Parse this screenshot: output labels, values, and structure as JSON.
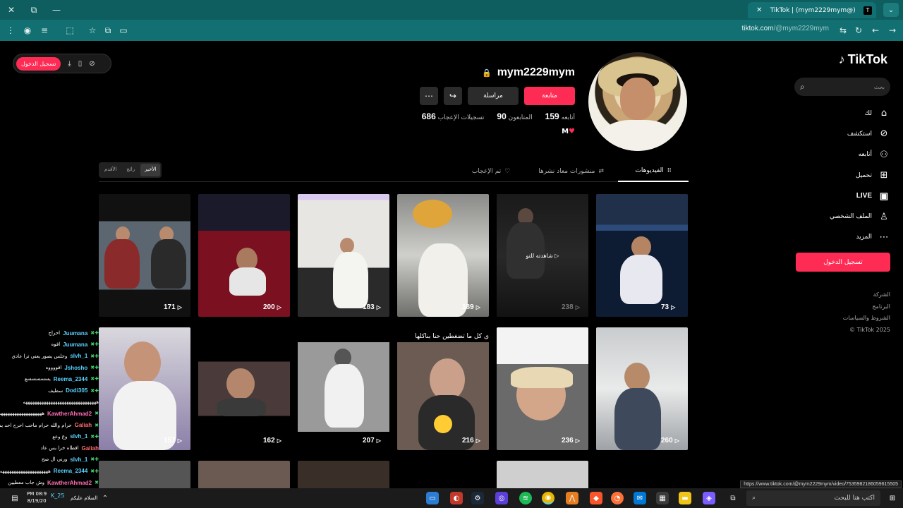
{
  "browser": {
    "tab_title": "TikTok | (mym2229mym@)",
    "tab_favicon": "T",
    "new_tab_label": "+",
    "window_controls": [
      "✕",
      "⧉",
      "—"
    ],
    "url_host": "tiktok.com",
    "url_path": "/@mym2229mym",
    "status_link": "https://www.tiktok.com/@mym2229mym/video/7535982186059615505"
  },
  "download_bar": {
    "login_label": "تسجيل الدخول"
  },
  "sidebar": {
    "logo": "TikTok",
    "search_placeholder": "بحث",
    "items": [
      {
        "label": "لك",
        "icon": "home-icon"
      },
      {
        "label": "استكشف",
        "icon": "compass-icon"
      },
      {
        "label": "أتابعه",
        "icon": "following-icon"
      },
      {
        "label": "تحميل",
        "icon": "upload-icon"
      },
      {
        "label": "LIVE",
        "icon": "live-icon"
      },
      {
        "label": "الملف الشخصي",
        "icon": "profile-icon"
      },
      {
        "label": "المزيد",
        "icon": "more-icon"
      }
    ],
    "login_label": "تسجيل الدخول",
    "footer": [
      "الشركة",
      "البرنامج",
      "الشروط والسياسات",
      "© TikTok 2025"
    ]
  },
  "profile": {
    "username": "mym2229mym",
    "follow_label": "متابعة",
    "message_label": "مراسلة",
    "following_label": "أتابعه",
    "following_count": "159",
    "followers_label": "المتابعون",
    "followers_count": "90",
    "likes_label": "تسجيلات الإعجاب",
    "likes_count": "686",
    "bio": "M"
  },
  "tabs": {
    "videos": "الفيديوهات",
    "reposts": "منشورات معاد نشرها",
    "liked": "تم الإعجاب",
    "sort": [
      "الأخير",
      "رائج",
      "الأقدم"
    ]
  },
  "videos": [
    {
      "views": "73"
    },
    {
      "views": "238",
      "overlay": "شاهدته للتو"
    },
    {
      "views": "189"
    },
    {
      "views": "183"
    },
    {
      "views": "200"
    },
    {
      "views": "171"
    },
    {
      "views": "260"
    },
    {
      "views": "236"
    },
    {
      "views": "216",
      "caption": "ى كل ما تضغطين حنا بناكلها"
    },
    {
      "views": "207"
    },
    {
      "views": "162"
    },
    {
      "views": "157"
    }
  ],
  "chat": [
    {
      "user": "Juumana",
      "msg": "احراج",
      "color": "blue"
    },
    {
      "user": "Juumana",
      "msg": "افوه",
      "color": "blue"
    },
    {
      "user": "slvh_1",
      "msg": "وجلس يصور يعني ترا عادي",
      "color": "blue"
    },
    {
      "user": "Jshosho",
      "msg": "افووووه",
      "color": "blue"
    },
    {
      "user": "Reema_2344",
      "msg": "يسسسسسع",
      "color": "blue"
    },
    {
      "user": "Dodi305",
      "msg": "سطيف",
      "color": "blue"
    },
    {
      "user": "",
      "msg": "ههههههههههههههههههههههههههههههههه",
      "color": "blue"
    },
    {
      "user": "KawtherAhmad2",
      "msg": "هههههههههههههههههههه",
      "color": "pink"
    },
    {
      "user": "Galiah",
      "msg": "حرام والله حرام ماحب احرج احد يمه",
      "color": "red"
    },
    {
      "user": "slvh_1",
      "msg": "وع وعع",
      "color": "blue"
    },
    {
      "user": "Galiah",
      "msg": "افطاه خرا بس عاد",
      "color": "red"
    },
    {
      "user": "slvh_1",
      "msg": "ورني ال صح",
      "color": "blue"
    },
    {
      "user": "Reema_2344",
      "msg": "هههههههههههههههههههههه",
      "color": "blue"
    },
    {
      "user": "KawtherAhmad2",
      "msg": "وش جاب معطيين",
      "color": "pink"
    }
  ],
  "taskbar": {
    "search_placeholder": "اكتب هنا للبحث",
    "time": "PM 08:9",
    "date": "8/19/20",
    "tray_user": "K_25",
    "tray_text": "السلام عليكم"
  }
}
